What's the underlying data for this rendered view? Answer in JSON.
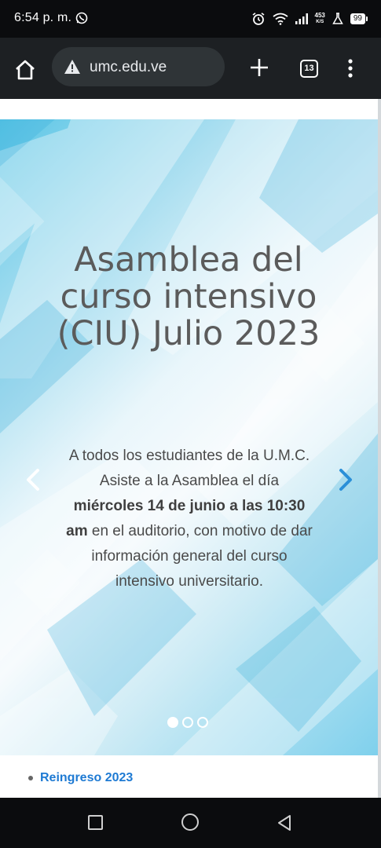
{
  "status_bar": {
    "time": "6:54 p. m.",
    "netspeed_value": "453",
    "netspeed_unit": "K/S",
    "battery": "99"
  },
  "browser": {
    "url": "umc.edu.ve",
    "tab_count": "13"
  },
  "carousel": {
    "title": "Asamblea del curso intensivo (CIU) Julio 2023",
    "text_part1": "A todos los estudiantes de la U.M.C. Asiste a la Asamblea el día ",
    "text_bold": "miércoles 14 de junio a las 10:30 am",
    "text_part2": " en el auditorio, con motivo de dar información general del curso intensivo universitario.",
    "slides_count": 3,
    "active_slide": 0
  },
  "news": {
    "items": [
      {
        "label": "Reingreso 2023"
      }
    ]
  },
  "colors": {
    "link": "#1e7ad3",
    "accent_arrow": "#2a8fd8"
  }
}
